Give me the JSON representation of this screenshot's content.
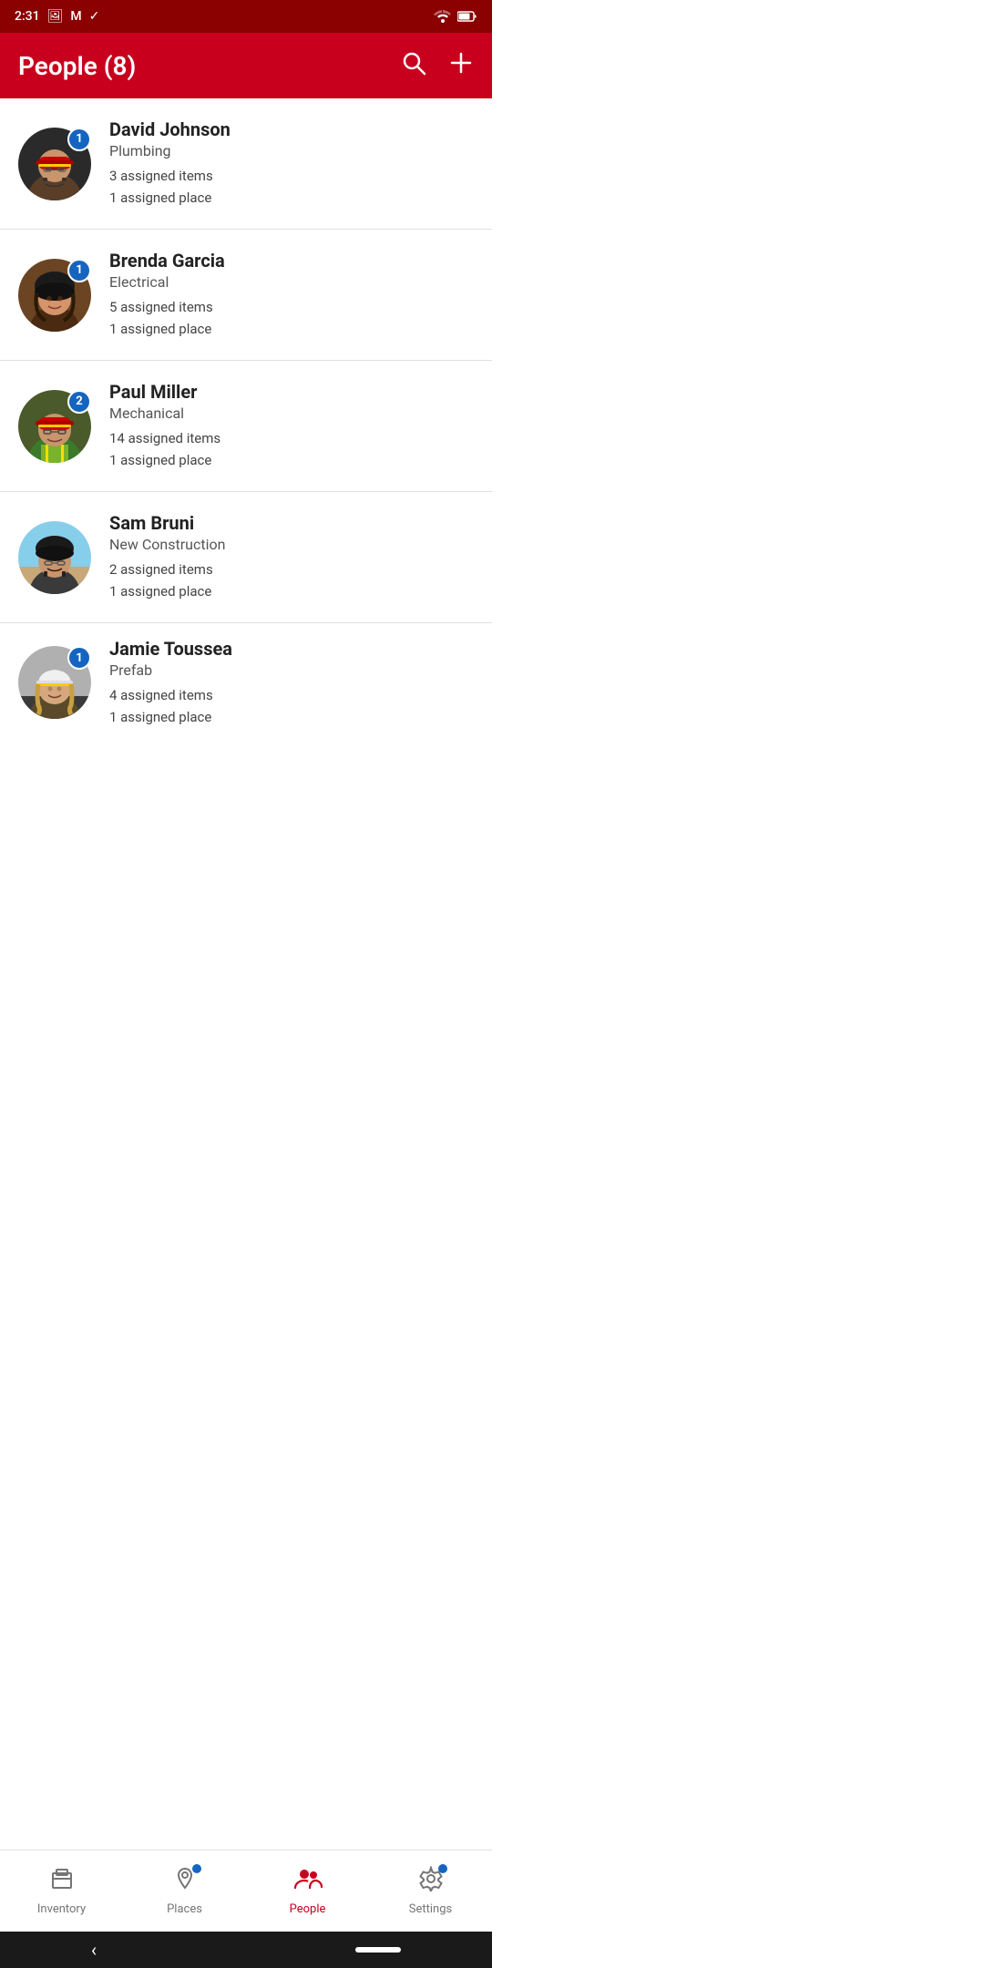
{
  "statusBar": {
    "time": "2:31",
    "icons": [
      "photo-icon",
      "gmail-icon",
      "tasks-icon"
    ],
    "rightIcons": [
      "wifi-icon",
      "battery-icon"
    ]
  },
  "header": {
    "title": "People (8)",
    "searchLabel": "search",
    "addLabel": "add"
  },
  "people": [
    {
      "id": 1,
      "name": "David Johnson",
      "department": "Plumbing",
      "assignedItems": "3 assigned items",
      "assignedPlace": "1 assigned place",
      "badge": "1",
      "hasBadge": true,
      "avatarColor": "#3a3a3a",
      "avatarIndex": 0
    },
    {
      "id": 2,
      "name": "Brenda Garcia",
      "department": "Electrical",
      "assignedItems": "5 assigned items",
      "assignedPlace": "1 assigned place",
      "badge": "1",
      "hasBadge": true,
      "avatarColor": "#8B6914",
      "avatarIndex": 1
    },
    {
      "id": 3,
      "name": "Paul Miller",
      "department": "Mechanical",
      "assignedItems": "14 assigned items",
      "assignedPlace": "1 assigned place",
      "badge": "2",
      "hasBadge": true,
      "avatarColor": "#556B2F",
      "avatarIndex": 2
    },
    {
      "id": 4,
      "name": "Sam Bruni",
      "department": "New Construction",
      "assignedItems": "2 assigned items",
      "assignedPlace": "1 assigned place",
      "badge": null,
      "hasBadge": false,
      "avatarColor": "#87CEEB",
      "avatarIndex": 3
    },
    {
      "id": 5,
      "name": "Jamie Toussea",
      "department": "Prefab",
      "assignedItems": "4 assigned items",
      "assignedPlace": "1 assigned place",
      "badge": "1",
      "hasBadge": true,
      "avatarColor": "#b0b0b0",
      "avatarIndex": 4
    }
  ],
  "bottomNav": {
    "items": [
      {
        "id": "inventory",
        "label": "Inventory",
        "active": false,
        "hasDot": false
      },
      {
        "id": "places",
        "label": "Places",
        "active": false,
        "hasDot": true
      },
      {
        "id": "people",
        "label": "People",
        "active": true,
        "hasDot": false
      },
      {
        "id": "settings",
        "label": "Settings",
        "active": false,
        "hasDot": true
      }
    ]
  },
  "systemNav": {
    "backSymbol": "‹"
  }
}
